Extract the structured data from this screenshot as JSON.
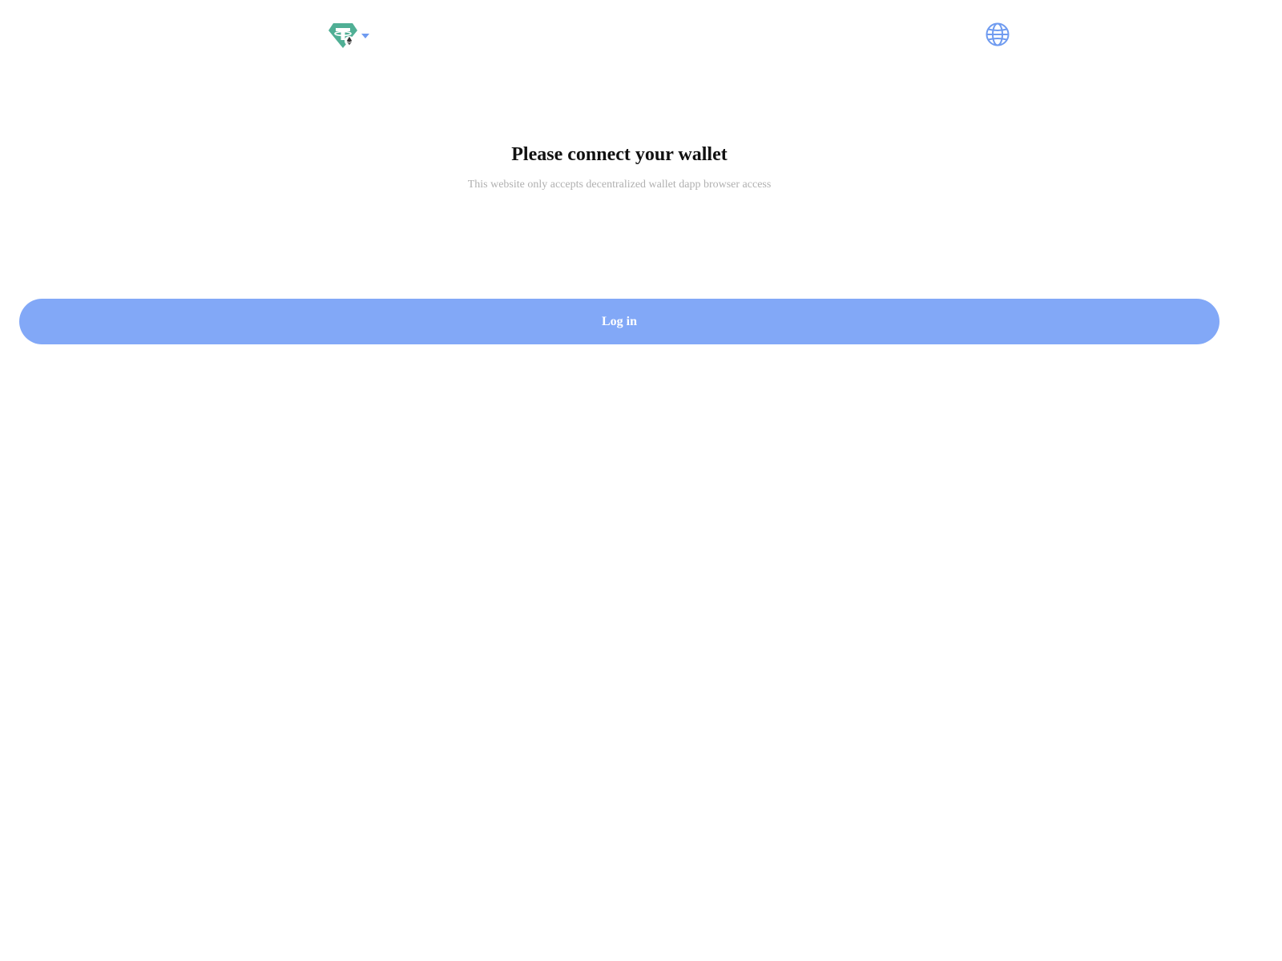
{
  "header": {
    "token_icon": "tether-usdt-logo-icon",
    "token_badge_icon": "ethereum-icon",
    "dropdown_icon": "caret-down-icon",
    "language_icon": "globe-icon"
  },
  "main": {
    "title": "Please connect your wallet",
    "subtitle": "This website only accepts decentralized wallet dapp browser access",
    "login_label": "Log in"
  },
  "colors": {
    "accent": "#82a8f7",
    "token_green": "#50af95",
    "globe_blue": "#6f9bf0",
    "title_text": "#111111",
    "subtitle_text": "#b0b0b0",
    "background": "#ffffff"
  }
}
